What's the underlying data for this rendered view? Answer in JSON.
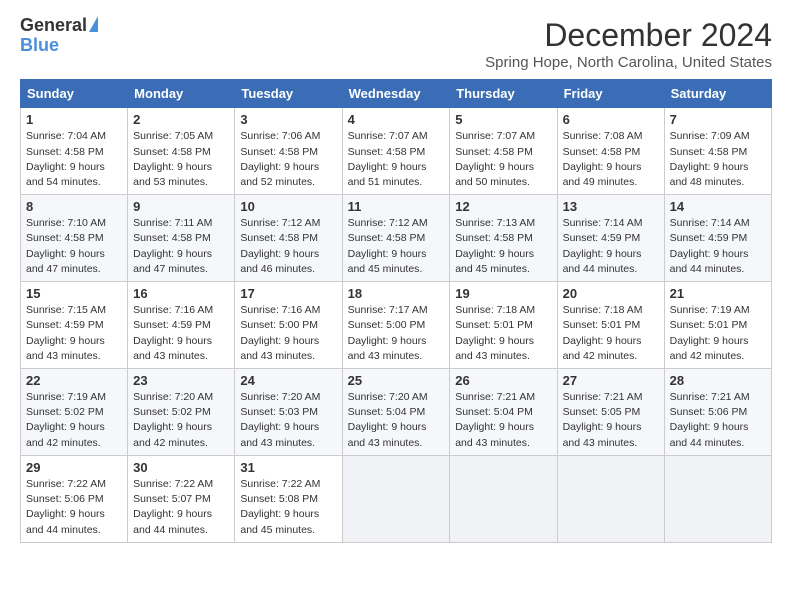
{
  "header": {
    "logo_general": "General",
    "logo_blue": "Blue",
    "month": "December 2024",
    "location": "Spring Hope, North Carolina, United States"
  },
  "weekdays": [
    "Sunday",
    "Monday",
    "Tuesday",
    "Wednesday",
    "Thursday",
    "Friday",
    "Saturday"
  ],
  "weeks": [
    [
      {
        "day": "1",
        "sunrise": "Sunrise: 7:04 AM",
        "sunset": "Sunset: 4:58 PM",
        "daylight": "Daylight: 9 hours and 54 minutes."
      },
      {
        "day": "2",
        "sunrise": "Sunrise: 7:05 AM",
        "sunset": "Sunset: 4:58 PM",
        "daylight": "Daylight: 9 hours and 53 minutes."
      },
      {
        "day": "3",
        "sunrise": "Sunrise: 7:06 AM",
        "sunset": "Sunset: 4:58 PM",
        "daylight": "Daylight: 9 hours and 52 minutes."
      },
      {
        "day": "4",
        "sunrise": "Sunrise: 7:07 AM",
        "sunset": "Sunset: 4:58 PM",
        "daylight": "Daylight: 9 hours and 51 minutes."
      },
      {
        "day": "5",
        "sunrise": "Sunrise: 7:07 AM",
        "sunset": "Sunset: 4:58 PM",
        "daylight": "Daylight: 9 hours and 50 minutes."
      },
      {
        "day": "6",
        "sunrise": "Sunrise: 7:08 AM",
        "sunset": "Sunset: 4:58 PM",
        "daylight": "Daylight: 9 hours and 49 minutes."
      },
      {
        "day": "7",
        "sunrise": "Sunrise: 7:09 AM",
        "sunset": "Sunset: 4:58 PM",
        "daylight": "Daylight: 9 hours and 48 minutes."
      }
    ],
    [
      {
        "day": "8",
        "sunrise": "Sunrise: 7:10 AM",
        "sunset": "Sunset: 4:58 PM",
        "daylight": "Daylight: 9 hours and 47 minutes."
      },
      {
        "day": "9",
        "sunrise": "Sunrise: 7:11 AM",
        "sunset": "Sunset: 4:58 PM",
        "daylight": "Daylight: 9 hours and 47 minutes."
      },
      {
        "day": "10",
        "sunrise": "Sunrise: 7:12 AM",
        "sunset": "Sunset: 4:58 PM",
        "daylight": "Daylight: 9 hours and 46 minutes."
      },
      {
        "day": "11",
        "sunrise": "Sunrise: 7:12 AM",
        "sunset": "Sunset: 4:58 PM",
        "daylight": "Daylight: 9 hours and 45 minutes."
      },
      {
        "day": "12",
        "sunrise": "Sunrise: 7:13 AM",
        "sunset": "Sunset: 4:58 PM",
        "daylight": "Daylight: 9 hours and 45 minutes."
      },
      {
        "day": "13",
        "sunrise": "Sunrise: 7:14 AM",
        "sunset": "Sunset: 4:59 PM",
        "daylight": "Daylight: 9 hours and 44 minutes."
      },
      {
        "day": "14",
        "sunrise": "Sunrise: 7:14 AM",
        "sunset": "Sunset: 4:59 PM",
        "daylight": "Daylight: 9 hours and 44 minutes."
      }
    ],
    [
      {
        "day": "15",
        "sunrise": "Sunrise: 7:15 AM",
        "sunset": "Sunset: 4:59 PM",
        "daylight": "Daylight: 9 hours and 43 minutes."
      },
      {
        "day": "16",
        "sunrise": "Sunrise: 7:16 AM",
        "sunset": "Sunset: 4:59 PM",
        "daylight": "Daylight: 9 hours and 43 minutes."
      },
      {
        "day": "17",
        "sunrise": "Sunrise: 7:16 AM",
        "sunset": "Sunset: 5:00 PM",
        "daylight": "Daylight: 9 hours and 43 minutes."
      },
      {
        "day": "18",
        "sunrise": "Sunrise: 7:17 AM",
        "sunset": "Sunset: 5:00 PM",
        "daylight": "Daylight: 9 hours and 43 minutes."
      },
      {
        "day": "19",
        "sunrise": "Sunrise: 7:18 AM",
        "sunset": "Sunset: 5:01 PM",
        "daylight": "Daylight: 9 hours and 43 minutes."
      },
      {
        "day": "20",
        "sunrise": "Sunrise: 7:18 AM",
        "sunset": "Sunset: 5:01 PM",
        "daylight": "Daylight: 9 hours and 42 minutes."
      },
      {
        "day": "21",
        "sunrise": "Sunrise: 7:19 AM",
        "sunset": "Sunset: 5:01 PM",
        "daylight": "Daylight: 9 hours and 42 minutes."
      }
    ],
    [
      {
        "day": "22",
        "sunrise": "Sunrise: 7:19 AM",
        "sunset": "Sunset: 5:02 PM",
        "daylight": "Daylight: 9 hours and 42 minutes."
      },
      {
        "day": "23",
        "sunrise": "Sunrise: 7:20 AM",
        "sunset": "Sunset: 5:02 PM",
        "daylight": "Daylight: 9 hours and 42 minutes."
      },
      {
        "day": "24",
        "sunrise": "Sunrise: 7:20 AM",
        "sunset": "Sunset: 5:03 PM",
        "daylight": "Daylight: 9 hours and 43 minutes."
      },
      {
        "day": "25",
        "sunrise": "Sunrise: 7:20 AM",
        "sunset": "Sunset: 5:04 PM",
        "daylight": "Daylight: 9 hours and 43 minutes."
      },
      {
        "day": "26",
        "sunrise": "Sunrise: 7:21 AM",
        "sunset": "Sunset: 5:04 PM",
        "daylight": "Daylight: 9 hours and 43 minutes."
      },
      {
        "day": "27",
        "sunrise": "Sunrise: 7:21 AM",
        "sunset": "Sunset: 5:05 PM",
        "daylight": "Daylight: 9 hours and 43 minutes."
      },
      {
        "day": "28",
        "sunrise": "Sunrise: 7:21 AM",
        "sunset": "Sunset: 5:06 PM",
        "daylight": "Daylight: 9 hours and 44 minutes."
      }
    ],
    [
      {
        "day": "29",
        "sunrise": "Sunrise: 7:22 AM",
        "sunset": "Sunset: 5:06 PM",
        "daylight": "Daylight: 9 hours and 44 minutes."
      },
      {
        "day": "30",
        "sunrise": "Sunrise: 7:22 AM",
        "sunset": "Sunset: 5:07 PM",
        "daylight": "Daylight: 9 hours and 44 minutes."
      },
      {
        "day": "31",
        "sunrise": "Sunrise: 7:22 AM",
        "sunset": "Sunset: 5:08 PM",
        "daylight": "Daylight: 9 hours and 45 minutes."
      },
      null,
      null,
      null,
      null
    ]
  ]
}
